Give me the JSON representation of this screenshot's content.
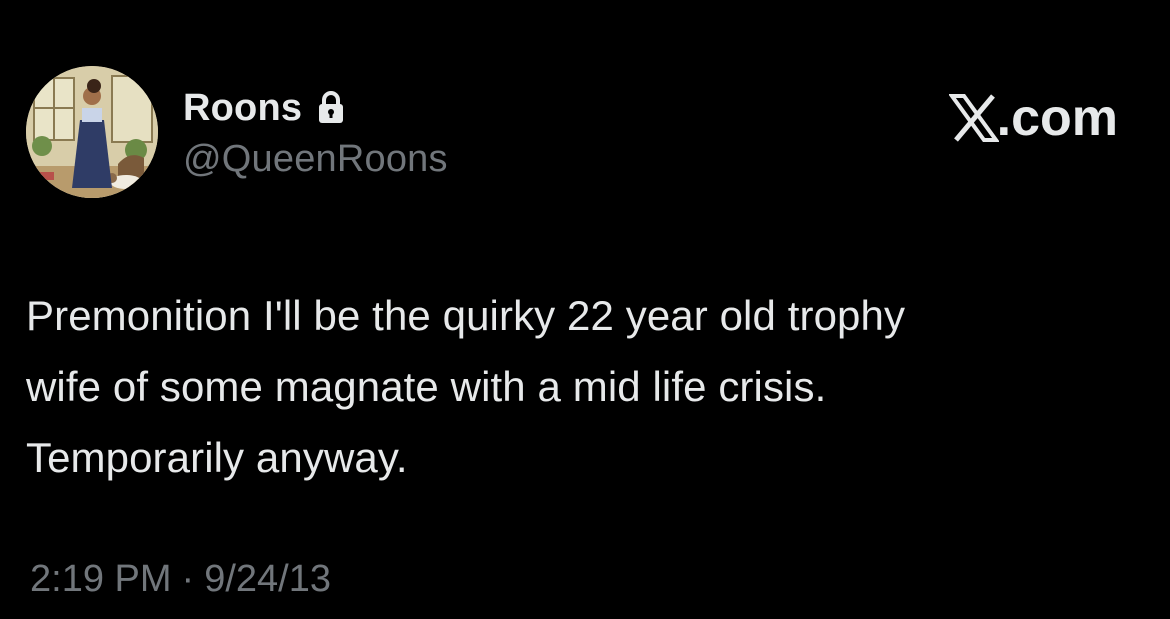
{
  "user": {
    "display_name": "Roons",
    "handle": "@QueenRoons",
    "protected_icon": "lock-icon",
    "avatar_icon": "profile-avatar"
  },
  "site": {
    "logo_icon": "x-logo-icon",
    "name": ".com"
  },
  "tweet": {
    "text": "Premonition I'll be the quirky 22 year old trophy\nwife of some magnate with a mid life crisis.\nTemporarily anyway.",
    "time": "2:19 PM",
    "separator": "·",
    "date": "9/24/13"
  },
  "colors": {
    "background": "#000000",
    "primary_text": "#e7e9ea",
    "secondary_text": "#71767b"
  }
}
